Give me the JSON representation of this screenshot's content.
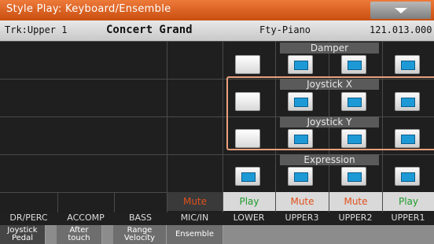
{
  "title_bar": {
    "title": "Style Play: Keyboard/Ensemble",
    "menu_icon": "chevron-down-icon"
  },
  "track_info": {
    "track": "Trk:Upper 1",
    "sound": "Concert Grand",
    "bank": "Fty-Piano",
    "number": "121.013.000"
  },
  "sections": {
    "damper": "Damper",
    "joystick_x": "Joystick X",
    "joystick_y": "Joystick Y",
    "expression": "Expression"
  },
  "status": {
    "mic_in": "Mute",
    "lower": "Play",
    "upper3": "Mute",
    "upper2": "Mute",
    "upper1": "Play"
  },
  "channels": [
    "DR/PERC",
    "ACCOMP",
    "BASS",
    "MIC/IN",
    "LOWER",
    "UPPER3",
    "UPPER2",
    "UPPER1"
  ],
  "tabs": {
    "joystick": "Joystick\nPedal",
    "after": "After\ntouch",
    "range": "Range\nVelocity",
    "ensemble": "Ensemble"
  },
  "colors": {
    "accent": "#e4621f",
    "highlight": "#e9a07c",
    "pad_on": "#1d9ad6",
    "play": "#1d9a2a",
    "mute": "#e0501c"
  }
}
